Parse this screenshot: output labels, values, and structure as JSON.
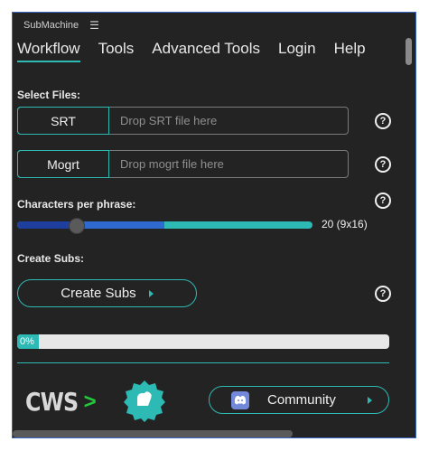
{
  "app": {
    "title": "SubMachine",
    "menu_icon": "hamburger-icon"
  },
  "nav": {
    "tabs": [
      {
        "label": "Workflow",
        "active": true
      },
      {
        "label": "Tools",
        "active": false
      },
      {
        "label": "Advanced Tools",
        "active": false
      },
      {
        "label": "Login",
        "active": false
      },
      {
        "label": "Help",
        "active": false
      }
    ]
  },
  "select_files": {
    "label": "Select Files:",
    "srt": {
      "type": "SRT",
      "placeholder": "Drop SRT file here"
    },
    "mogrt": {
      "type": "Mogrt",
      "placeholder": "Drop mogrt file here"
    }
  },
  "chars_per_phrase": {
    "label": "Characters per phrase:",
    "value_text": "20 (9x16)",
    "slider_fraction": 0.2,
    "mid_fraction": 0.5
  },
  "create_subs": {
    "label": "Create Subs:",
    "button": "Create Subs"
  },
  "progress": {
    "percent": 0,
    "text": "0%"
  },
  "footer": {
    "logo_text": "CWS",
    "logo_chevron": ">",
    "community_button": "Community"
  },
  "colors": {
    "accent": "#2dbab4",
    "panel": "#232323",
    "discord": "#7289da",
    "cws_chevron": "#23c93a"
  }
}
